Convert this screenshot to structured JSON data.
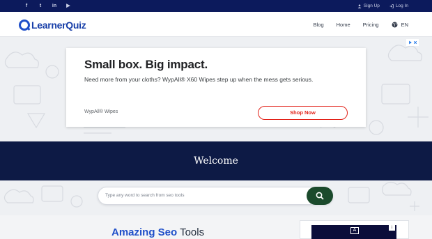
{
  "topbar": {
    "social": [
      {
        "icon": "facebook-icon",
        "glyph": "f"
      },
      {
        "icon": "twitter-icon",
        "glyph": "t"
      },
      {
        "icon": "linkedin-icon",
        "glyph": "in"
      },
      {
        "icon": "youtube-icon",
        "glyph": "▶"
      }
    ],
    "signup_label": "Sign Up",
    "login_label": "Log In"
  },
  "navbar": {
    "logo_text": "LearnerQuiz",
    "links": [
      "Blog",
      "Home",
      "Pricing"
    ],
    "language": "EN"
  },
  "ad": {
    "headline": "Small box. Big impact.",
    "body": "Need more from your cloths? WypAll® X60 Wipes step up when the mess gets serious.",
    "advertiser": "WypAll® Wipes",
    "cta": "Shop Now"
  },
  "hero": {
    "title": "Welcome"
  },
  "search": {
    "placeholder": "Type any word to search from seo tools"
  },
  "main": {
    "title_accent": "Amazing Seo",
    "title_rest": "Tools"
  },
  "colors": {
    "topbar": "#0c1a5c",
    "hero": "#0d1a45",
    "brand_blue": "#1f4fc9",
    "search_button": "#1b4a2c",
    "ad_cta": "#e2231a"
  }
}
